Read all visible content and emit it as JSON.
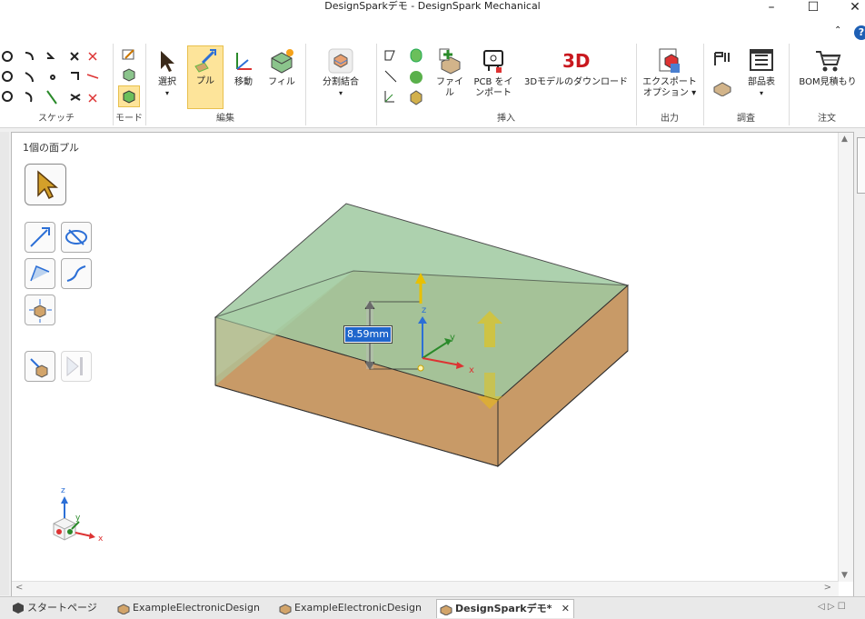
{
  "window": {
    "title": "DesignSparkデモ - DesignSpark Mechanical"
  },
  "ribbon": {
    "groups": {
      "sketch": "スケッチ",
      "mode": "モード",
      "edit": "編集",
      "insert": "挿入",
      "output": "出力",
      "investigate": "調査",
      "order": "注文"
    },
    "tools": {
      "select": "選択",
      "pull": "プル",
      "move": "移動",
      "fill": "フィル",
      "split_combine": "分割結合",
      "file": "ファイル",
      "pcb_import_1": "PCB をイ",
      "pcb_import_2": "ンポート",
      "download_3d": "3Dモデルのダウンロード",
      "export_1": "エクスポート",
      "export_2": "オプション",
      "bom_parts": "部品表",
      "bom_quote": "BOM見積もり"
    },
    "help": "?"
  },
  "viewport": {
    "status": "1個の面プル",
    "dimension_value": "8.59mm",
    "axis_labels": {
      "x": "x",
      "y": "y",
      "z": "z"
    }
  },
  "tabs": [
    {
      "label": "スタートページ"
    },
    {
      "label": "ExampleElectronicDesign"
    },
    {
      "label": "ExampleElectronicDesign"
    },
    {
      "label": "DesignSparkデモ*"
    }
  ],
  "colors": {
    "top_face": "#9fc9a0",
    "side_face": "#c89a66",
    "active_tool": "#fde49a",
    "dimension_bg": "#1f66cc"
  }
}
